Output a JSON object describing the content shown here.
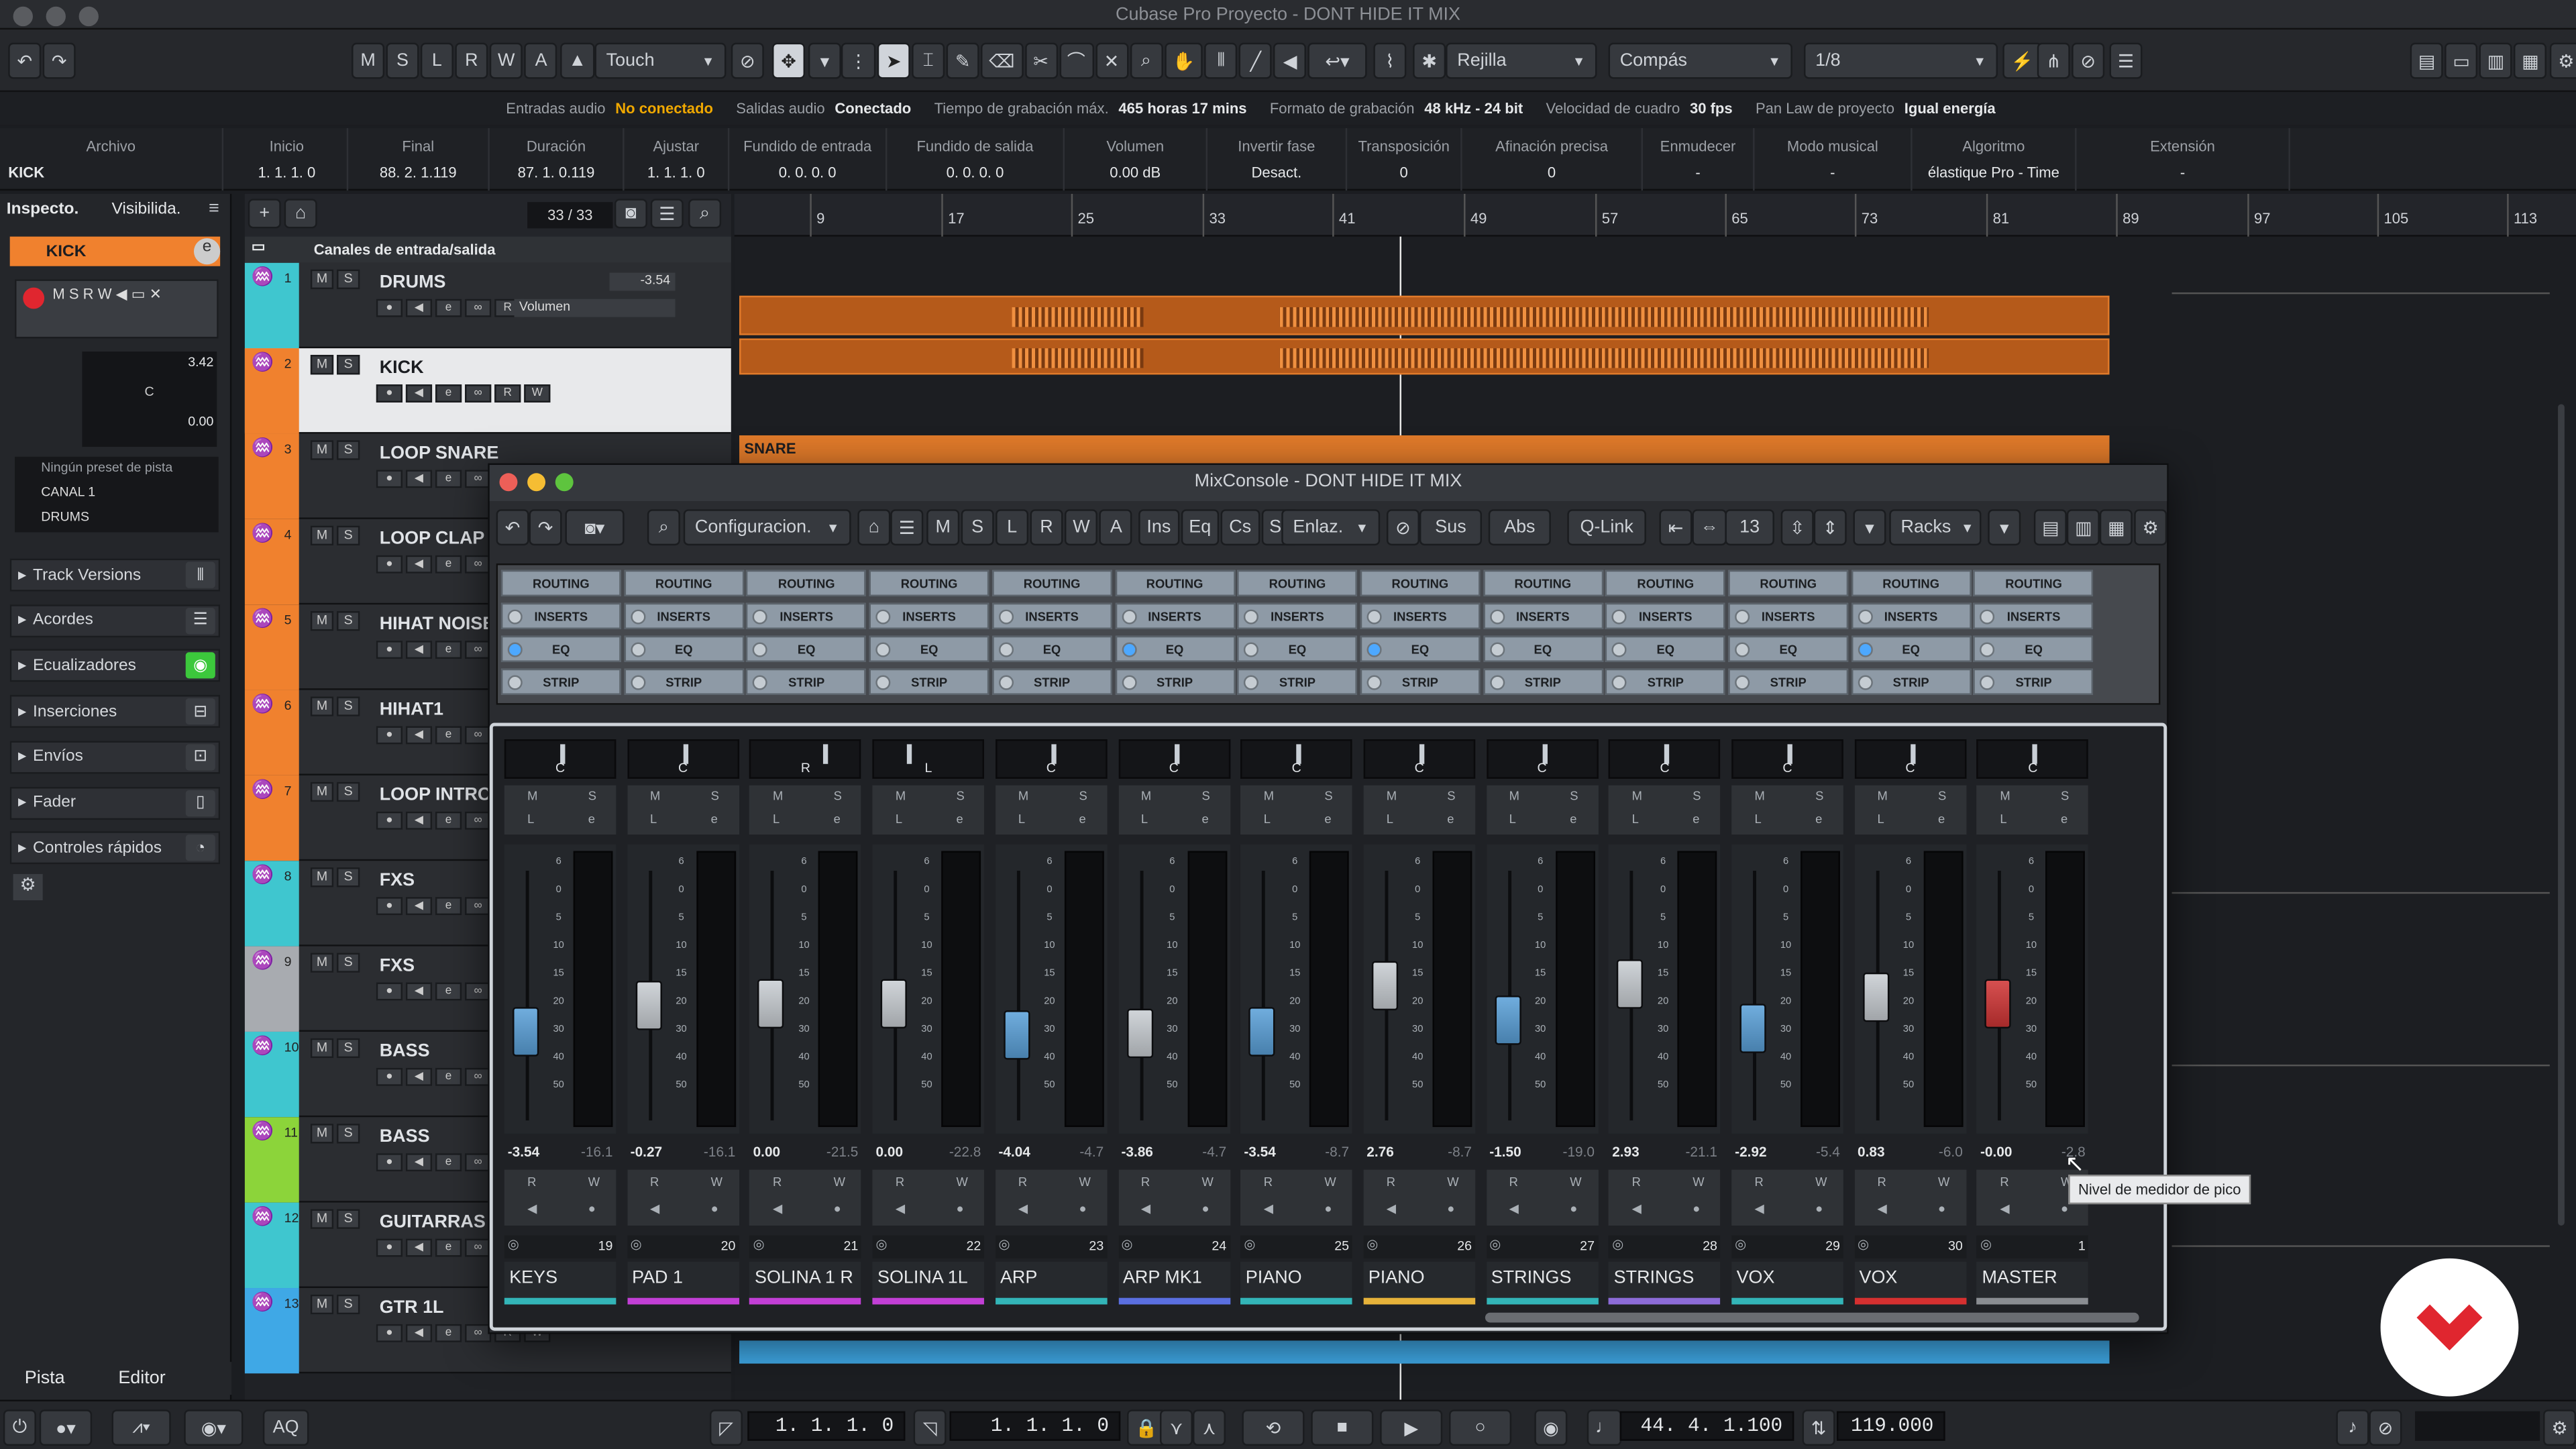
{
  "window": {
    "title": "Cubase Pro Proyecto - DONT HIDE IT MIX"
  },
  "toolbar": {
    "mode_buttons": [
      "M",
      "S",
      "L",
      "R",
      "W",
      "A"
    ],
    "automation_mode": "Touch",
    "grid_type": "Rejilla",
    "grid_ruler": "Compás",
    "quantize": "1/8"
  },
  "status_line": [
    {
      "label": "Entradas audio",
      "value": "No conectado",
      "warn": true
    },
    {
      "label": "Salidas audio",
      "value": "Conectado",
      "warn": false
    },
    {
      "label": "Tiempo de grabación máx.",
      "value": "465 horas 17 mins",
      "warn": false
    },
    {
      "label": "Formato de grabación",
      "value": "48 kHz - 24 bit",
      "warn": false
    },
    {
      "label": "Velocidad de cuadro",
      "value": "30 fps",
      "warn": false
    },
    {
      "label": "Pan Law de proyecto",
      "value": "Igual energía",
      "warn": false
    }
  ],
  "info_line": [
    {
      "h": "Archivo",
      "v": "KICK"
    },
    {
      "h": "Inicio",
      "v": "1. 1. 1.   0"
    },
    {
      "h": "Final",
      "v": "88. 2. 1.119"
    },
    {
      "h": "Duración",
      "v": "87. 1. 0.119"
    },
    {
      "h": "Ajustar",
      "v": "1. 1. 1.   0"
    },
    {
      "h": "Fundido de entrada",
      "v": "0. 0. 0.   0"
    },
    {
      "h": "Fundido de salida",
      "v": "0. 0. 0.   0"
    },
    {
      "h": "Volumen",
      "v": "0.00         dB"
    },
    {
      "h": "Invertir fase",
      "v": "Desact."
    },
    {
      "h": "Transposición",
      "v": "0"
    },
    {
      "h": "Afinación precisa",
      "v": "0"
    },
    {
      "h": "Enmudecer",
      "v": "-"
    },
    {
      "h": "Modo musical",
      "v": "-"
    },
    {
      "h": "Algoritmo",
      "v": "élastique Pro - Time"
    },
    {
      "h": "Extensión",
      "v": "-"
    }
  ],
  "inspector": {
    "tabs": [
      "Inspecto.",
      "Visibilida."
    ],
    "track_name": "KICK",
    "volume": "3.42",
    "pan": "C",
    "delay": "0.00",
    "preset": "Ningún preset de pista",
    "input": "CANAL 1",
    "output": "DRUMS",
    "sections": [
      "Track Versions",
      "Acordes",
      "Ecualizadores",
      "Inserciones",
      "Envíos",
      "Fader",
      "Controles rápidos"
    ],
    "page_tabs": [
      "Pista",
      "Editor"
    ]
  },
  "tracklist": {
    "counter": "33 / 33",
    "folder": "Canales de entrada/salida",
    "volume_label": "Volumen",
    "drums_value": "-3.54",
    "tracks": [
      {
        "n": "1",
        "name": "DRUMS",
        "color": "#3fc6cf"
      },
      {
        "n": "2",
        "name": "KICK",
        "color": "#f0812e"
      },
      {
        "n": "3",
        "name": "LOOP SNARE",
        "color": "#f0812e"
      },
      {
        "n": "4",
        "name": "LOOP CLAP",
        "color": "#f0812e"
      },
      {
        "n": "5",
        "name": "HIHAT NOISE",
        "color": "#f0812e"
      },
      {
        "n": "6",
        "name": "HIHAT1",
        "color": "#f0812e"
      },
      {
        "n": "7",
        "name": "LOOP INTRO",
        "color": "#f0812e"
      },
      {
        "n": "8",
        "name": "FXS",
        "color": "#3fc6cf"
      },
      {
        "n": "9",
        "name": "FXS",
        "color": "#a8abb0"
      },
      {
        "n": "10",
        "name": "BASS",
        "color": "#3fc6cf"
      },
      {
        "n": "11",
        "name": "BASS",
        "color": "#8cd43a"
      },
      {
        "n": "12",
        "name": "GUITARRAS",
        "color": "#3fc6cf"
      },
      {
        "n": "13",
        "name": "GTR 1L",
        "color": "#3fa8e6"
      }
    ]
  },
  "ruler": {
    "bars": [
      "9",
      "17",
      "25",
      "33",
      "41",
      "49",
      "57",
      "65",
      "73",
      "81",
      "89",
      "97",
      "105",
      "113"
    ]
  },
  "arrange": {
    "snare_event": "SNARE"
  },
  "mixer": {
    "title": "MixConsole - DONT HIDE IT MIX",
    "config": "Configuracion.",
    "ms": [
      "M",
      "S",
      "L",
      "R",
      "W",
      "A"
    ],
    "sections": [
      "Ins",
      "Eq",
      "Cs",
      "Sd"
    ],
    "link": "Enlaz.",
    "sus": "Sus",
    "abs": "Abs",
    "qlink": "Q-Link",
    "count": "13",
    "racks_label": "Racks",
    "rack_rows": [
      "ROUTING",
      "INSERTS",
      "EQ",
      "STRIP"
    ],
    "channels": [
      {
        "name": "KEYS",
        "num": "19",
        "pan": "C",
        "vol": "-3.54",
        "peak": "-16.1",
        "fader": 0.68,
        "cap": "#5aa0d8",
        "color": "#33b5b8",
        "eq": true
      },
      {
        "name": "PAD 1",
        "num": "20",
        "pan": "C",
        "vol": "-0.27",
        "peak": "-16.1",
        "fader": 0.55,
        "cap": "#c9ced3",
        "color": "#c23fd6",
        "eq": false
      },
      {
        "name": "SOLINA 1 R",
        "num": "21",
        "pan": "R",
        "vol": "0.00",
        "peak": "-21.5",
        "fader": 0.54,
        "cap": "#c9ced3",
        "color": "#c23fd6",
        "eq": false
      },
      {
        "name": "SOLINA 1L",
        "num": "22",
        "pan": "L",
        "vol": "0.00",
        "peak": "-22.8",
        "fader": 0.54,
        "cap": "#c9ced3",
        "color": "#c23fd6",
        "eq": false
      },
      {
        "name": "ARP",
        "num": "23",
        "pan": "C",
        "vol": "-4.04",
        "peak": "-4.7",
        "fader": 0.7,
        "cap": "#5aa0d8",
        "color": "#33b5b8",
        "eq": false
      },
      {
        "name": "ARP MK1",
        "num": "24",
        "pan": "C",
        "vol": "-3.86",
        "peak": "-4.7",
        "fader": 0.69,
        "cap": "#c9ced3",
        "color": "#5a6fe0",
        "eq": true
      },
      {
        "name": "PIANO",
        "num": "25",
        "pan": "C",
        "vol": "-3.54",
        "peak": "-8.7",
        "fader": 0.68,
        "cap": "#5aa0d8",
        "color": "#33b5b8",
        "eq": false
      },
      {
        "name": "PIANO",
        "num": "26",
        "pan": "C",
        "vol": "2.76",
        "peak": "-8.7",
        "fader": 0.45,
        "cap": "#c9ced3",
        "color": "#e6b23a",
        "eq": true
      },
      {
        "name": "STRINGS",
        "num": "27",
        "pan": "C",
        "vol": "-1.50",
        "peak": "-19.0",
        "fader": 0.62,
        "cap": "#5aa0d8",
        "color": "#33b5b8",
        "eq": false
      },
      {
        "name": "STRINGS",
        "num": "28",
        "pan": "C",
        "vol": "2.93",
        "peak": "-21.1",
        "fader": 0.44,
        "cap": "#c9ced3",
        "color": "#8c6bd8",
        "eq": false
      },
      {
        "name": "VOX",
        "num": "29",
        "pan": "C",
        "vol": "-2.92",
        "peak": "-5.4",
        "fader": 0.66,
        "cap": "#5aa0d8",
        "color": "#33b5b8",
        "eq": false
      },
      {
        "name": "VOX",
        "num": "30",
        "pan": "C",
        "vol": "0.83",
        "peak": "-6.0",
        "fader": 0.51,
        "cap": "#c9ced3",
        "color": "#d63030",
        "eq": true
      },
      {
        "name": "MASTER",
        "num": "1",
        "pan": "C",
        "vol": "-0.00",
        "peak": "-2.8",
        "fader": 0.54,
        "cap": "#d03535",
        "color": "#8a8d92",
        "eq": false
      }
    ],
    "tooltip": "Nivel de medidor de pico"
  },
  "transport": {
    "left_locator": "1. 1. 1.   0",
    "right_locator": "1. 1. 1.   0",
    "position": "44. 4. 1.100",
    "tempo": "119.000",
    "aq": "AQ"
  }
}
